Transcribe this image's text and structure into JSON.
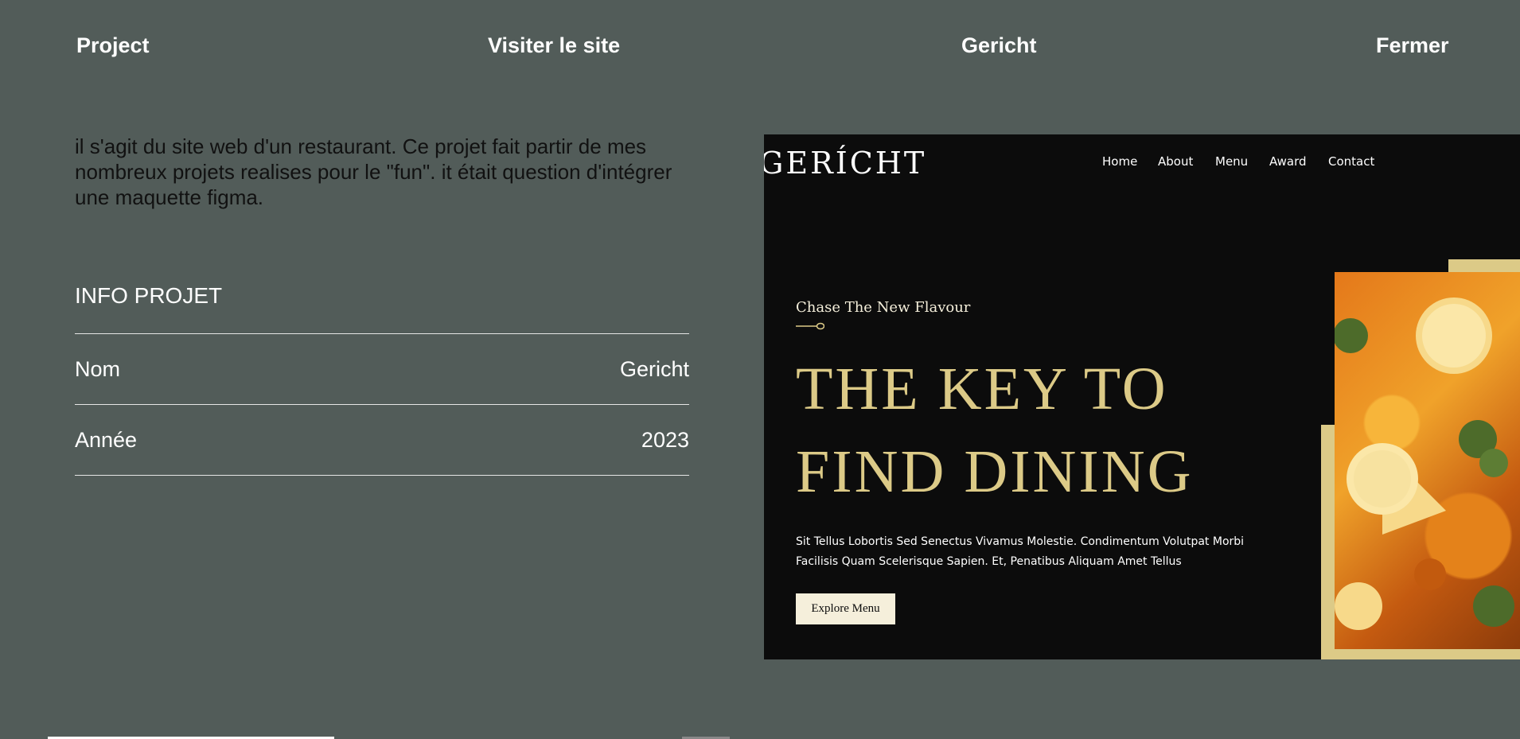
{
  "topnav": {
    "project": "Project",
    "visit": "Visiter le site",
    "name": "Gericht",
    "close": "Fermer"
  },
  "description": "il s'agit du site web d'un restaurant. Ce projet fait partir de mes nombreux projets realises pour le \"fun\". it était question d'intégrer une maquette figma.",
  "info": {
    "title": "INFO PROJET",
    "rows": [
      {
        "label": "Nom",
        "value": "Gericht"
      },
      {
        "label": "Année",
        "value": "2023"
      }
    ]
  },
  "preview": {
    "logo": "GERÍCHT",
    "nav": [
      "Home",
      "About",
      "Menu",
      "Award",
      "Contact"
    ],
    "subtitle": "Chase The New Flavour",
    "headline": "THE KEY TO FIND DINING",
    "paragraph": "Sit Tellus Lobortis Sed Senectus Vivamus Molestie. Condimentum Volutpat Morbi Facilisis Quam Scelerisque Sapien. Et, Penatibus Aliquam Amet Tellus",
    "button": "Explore Menu",
    "colors": {
      "bg": "#0c0c0c",
      "gold": "#dcca87",
      "cream": "#f5efdb"
    }
  },
  "colors": {
    "page_bg": "#525c59"
  }
}
